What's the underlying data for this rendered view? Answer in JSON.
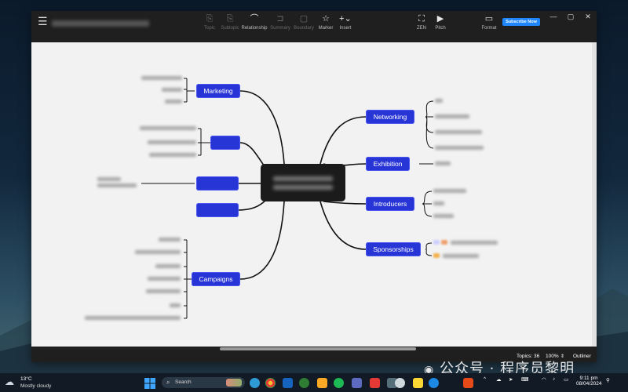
{
  "toolbar": {
    "tools": [
      {
        "label": "Topic",
        "icon": "topic-icon",
        "glyph": "⎘",
        "enabled": false
      },
      {
        "label": "Subtopic",
        "icon": "subtopic-icon",
        "glyph": "⎘",
        "enabled": false
      },
      {
        "label": "Relationship",
        "icon": "relationship-icon",
        "glyph": "⌒",
        "enabled": true
      },
      {
        "label": "Summary",
        "icon": "summary-icon",
        "glyph": "⊐",
        "enabled": false
      },
      {
        "label": "Boundary",
        "icon": "boundary-icon",
        "glyph": "▢",
        "enabled": false
      },
      {
        "label": "Marker",
        "icon": "marker-icon",
        "glyph": "☆",
        "enabled": true
      },
      {
        "label": "Insert",
        "icon": "insert-icon",
        "glyph": "+⌄",
        "enabled": true
      }
    ],
    "zen_label": "ZEN",
    "pitch_label": "Pitch",
    "format_label": "Format",
    "subscribe_label": "Subscribe Now"
  },
  "mindmap": {
    "branches_right": [
      {
        "label": "Networking"
      },
      {
        "label": "Exhibition"
      },
      {
        "label": "Introducers"
      },
      {
        "label": "Sponsorships"
      }
    ],
    "branches_left": [
      {
        "label": "Marketing"
      },
      {
        "label": "Campaigns"
      }
    ]
  },
  "statusbar": {
    "topics": "Topics: 36",
    "zoom": "100%",
    "outliner": "Outliner"
  },
  "taskbar": {
    "weather_temp": "13°C",
    "weather_desc": "Mostly cloudy",
    "search_placeholder": "Search",
    "time": "9:11 pm",
    "date": "08/04/2024"
  },
  "watermark": "公众号 · 程序员黎明",
  "colors": {
    "topic_blue": "#2735d6",
    "subscribe_blue": "#1e86ff",
    "chrome_dark": "#1f1f1f"
  }
}
